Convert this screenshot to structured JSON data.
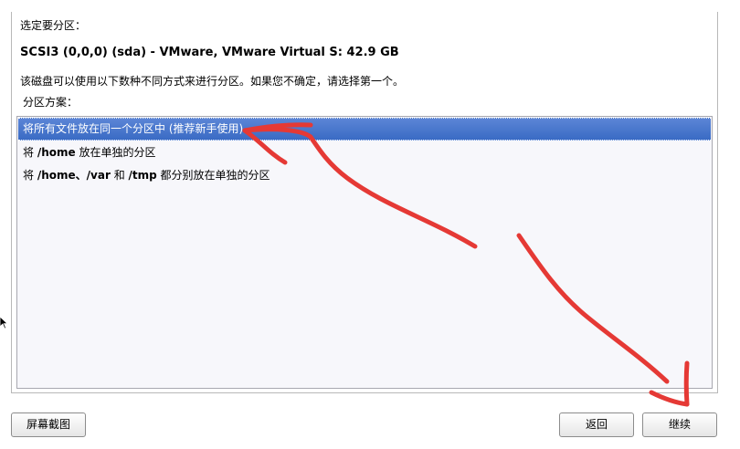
{
  "step": {
    "heading": "选定要分区：",
    "disk": "SCSI3 (0,0,0) (sda) - VMware, VMware Virtual S: 42.9 GB",
    "description": "该磁盘可以使用以下数种不同方式来进行分区。如果您不确定，请选择第一个。",
    "scheme_label": "分区方案："
  },
  "options": [
    {
      "text": "将所有文件放在同一个分区中 (推荐新手使用)",
      "selected": true
    },
    {
      "prefix": "将 ",
      "paths": "/home",
      "suffix": " 放在单独的分区",
      "selected": false
    },
    {
      "prefix": "将 ",
      "paths": "/home、/var",
      "mid": " 和 ",
      "paths2": "/tmp",
      "suffix": " 都分别放在单独的分区",
      "selected": false
    }
  ],
  "buttons": {
    "screenshot": "屏幕截图",
    "back": "返回",
    "continue": "继续"
  },
  "colors": {
    "selection": "#3a6bc4",
    "annotation": "#e53935"
  },
  "icons": {
    "cursor": "arrow-cursor-icon"
  }
}
